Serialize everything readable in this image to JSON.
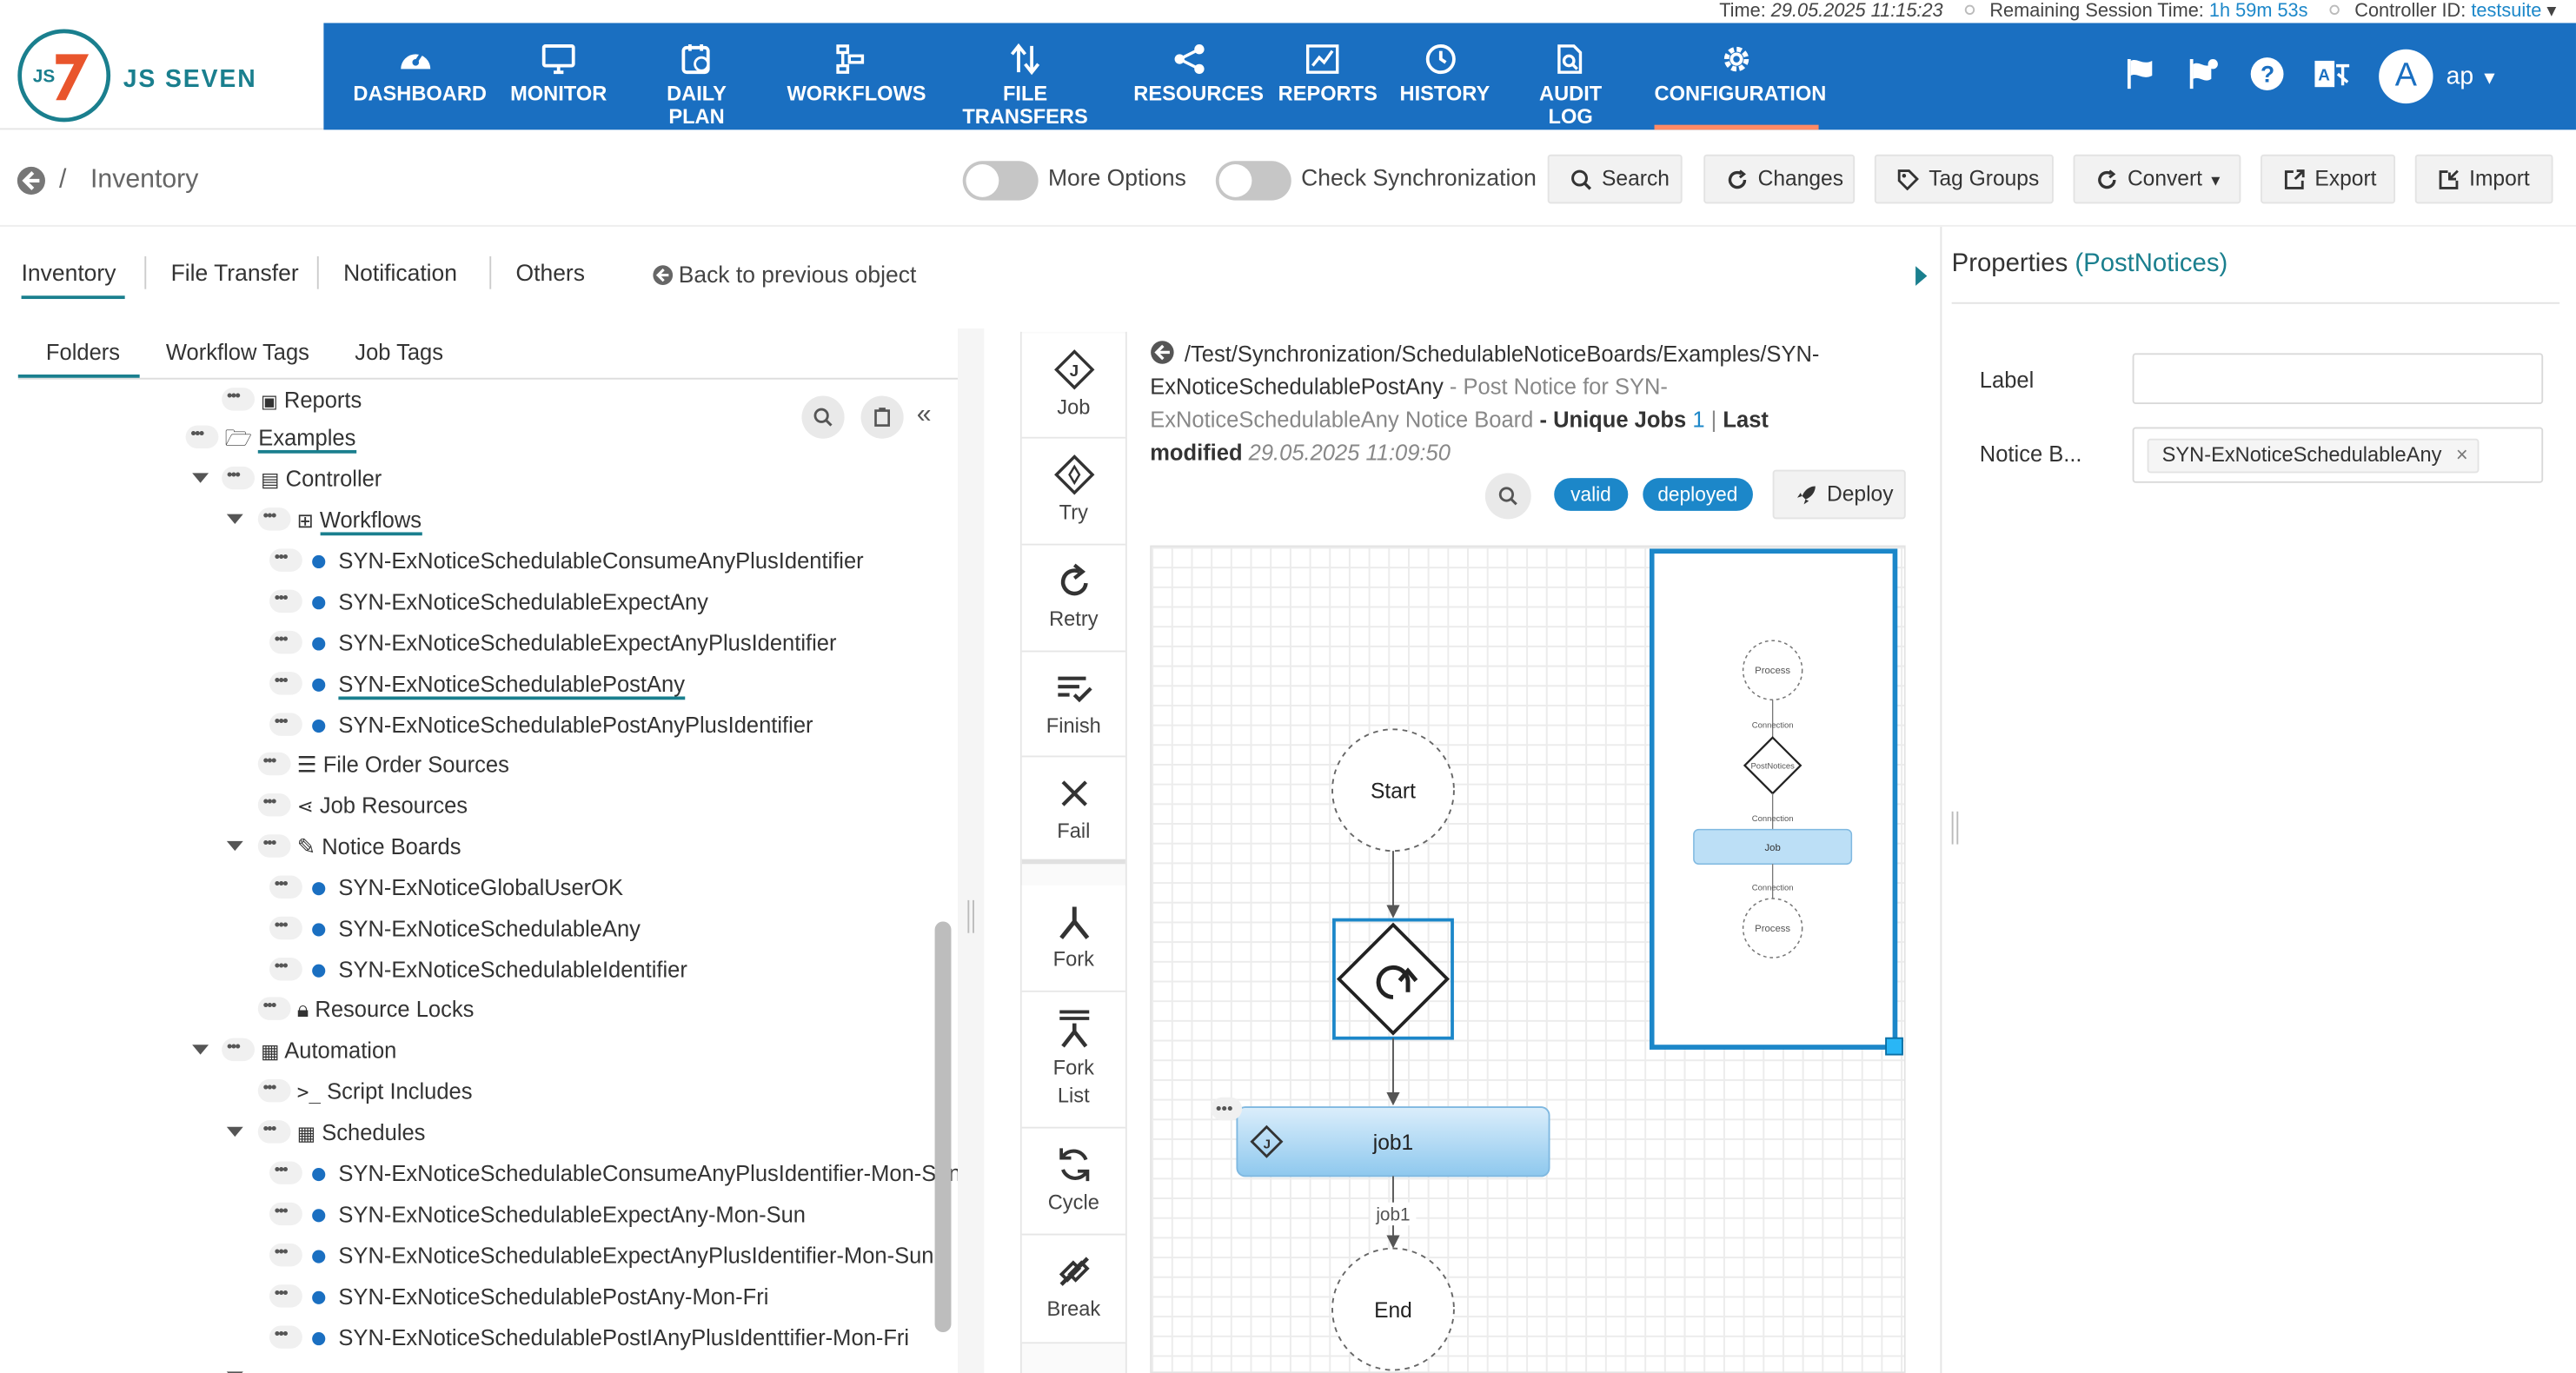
{
  "status": {
    "time_label": "Time:",
    "time_value": "29.05.2025 11:15:23",
    "session_label": "Remaining Session Time:",
    "session_value": "1h 59m 53s",
    "controller_label": "Controller ID:",
    "controller_value": "testsuite"
  },
  "logo": {
    "text": "JS SEVEN"
  },
  "nav": {
    "items": [
      {
        "label": "DASHBOARD",
        "icon": "dashboard-icon"
      },
      {
        "label": "MONITOR",
        "icon": "monitor-icon"
      },
      {
        "label": "DAILY PLAN",
        "icon": "calendar-icon"
      },
      {
        "label": "WORKFLOWS",
        "icon": "workflow-icon"
      },
      {
        "label": "FILE TRANSFERS",
        "icon": "transfer-icon"
      },
      {
        "label": "RESOURCES",
        "icon": "share-icon"
      },
      {
        "label": "REPORTS",
        "icon": "chart-icon"
      },
      {
        "label": "HISTORY",
        "icon": "history-icon"
      },
      {
        "label": "AUDIT LOG",
        "icon": "audit-icon"
      },
      {
        "label": "CONFIGURATION",
        "icon": "gear-icon"
      }
    ],
    "active": "CONFIGURATION",
    "avatar_letter": "A",
    "user": "ap"
  },
  "toolbar": {
    "breadcrumb": "Inventory",
    "breadcrumb_sep": "/",
    "more_options": "More Options",
    "check_sync": "Check Synchronization",
    "search": "Search",
    "changes": "Changes",
    "tag_groups": "Tag Groups",
    "convert": "Convert",
    "export": "Export",
    "import": "Import"
  },
  "tabs": {
    "primary": [
      "Inventory",
      "File Transfer",
      "Notification",
      "Others"
    ],
    "back": "Back to previous object",
    "secondary": [
      "Folders",
      "Workflow Tags",
      "Job Tags"
    ]
  },
  "tree": {
    "reports": "Reports",
    "examples": "Examples",
    "controller": "Controller",
    "workflows": "Workflows",
    "workflow_items": [
      "SYN-ExNoticeSchedulableConsumeAnyPlusIdentifier",
      "SYN-ExNoticeSchedulableExpectAny",
      "SYN-ExNoticeSchedulableExpectAnyPlusIdentifier",
      "SYN-ExNoticeSchedulablePostAny",
      "SYN-ExNoticeSchedulablePostAnyPlusIdentifier"
    ],
    "file_order_sources": "File Order Sources",
    "job_resources": "Job Resources",
    "notice_boards": "Notice Boards",
    "notice_board_items": [
      "SYN-ExNoticeGlobalUserOK",
      "SYN-ExNoticeSchedulableAny",
      "SYN-ExNoticeSchedulableIdentifier"
    ],
    "resource_locks": "Resource Locks",
    "automation": "Automation",
    "script_includes": "Script Includes",
    "schedules": "Schedules",
    "schedule_items": [
      "SYN-ExNoticeSchedulableConsumeAnyPlusIdentifier-Mon-Sun",
      "SYN-ExNoticeSchedulableExpectAny-Mon-Sun",
      "SYN-ExNoticeSchedulableExpectAnyPlusIdentifier-Mon-Sun",
      "SYN-ExNoticeSchedulablePostAny-Mon-Fri",
      "SYN-ExNoticeSchedulablePostIAnyPlusIdenttifier-Mon-Fri"
    ]
  },
  "palette": [
    {
      "label": "Job",
      "icon": "job-icon"
    },
    {
      "label": "Try",
      "icon": "try-icon"
    },
    {
      "label": "Retry",
      "icon": "retry-icon"
    },
    {
      "label": "Finish",
      "icon": "finish-icon"
    },
    {
      "label": "Fail",
      "icon": "fail-icon"
    },
    {
      "label": "Fork",
      "icon": "fork-icon"
    },
    {
      "label": "Fork List",
      "icon": "fork-list-icon"
    },
    {
      "label": "Cycle",
      "icon": "cycle-icon"
    },
    {
      "label": "Break",
      "icon": "break-icon"
    }
  ],
  "workflow": {
    "path_line1": "/Test/Synchronization/SchedulableNoticeBoards/Examples/SYN-",
    "path_line2": "ExNoticeSchedulablePostAny",
    "desc_line1": " - Post Notice for SYN-",
    "desc_line2a": "ExNoticeSchedulableAny Notice Board",
    "unique_jobs_label": " - Unique Jobs",
    "unique_jobs_value": "1",
    "last_label": "Last",
    "modified_label": "modified",
    "modified_value": "29.05.2025 11:09:50",
    "badge_valid": "valid",
    "badge_deployed": "deployed",
    "deploy": "Deploy"
  },
  "graph": {
    "start": "Start",
    "job": "job1",
    "edge_label": "job1",
    "end": "End"
  },
  "minimap": {
    "process1": "Process",
    "conn1": "Connection",
    "notice": "PostNotices",
    "conn2": "Connection",
    "job": "Job",
    "conn3": "Connection",
    "process2": "Process"
  },
  "properties": {
    "title": "Properties",
    "type": "(PostNotices)",
    "label_field": "Label",
    "label_value": "",
    "notice_field": "Notice B...",
    "notice_tag": "SYN-ExNoticeSchedulableAny"
  },
  "colors": {
    "nav_bg": "#1a6fc1",
    "accent_teal": "#1a7f8e",
    "active_underline": "#ff8a65",
    "badge_blue": "#1c87c9"
  }
}
